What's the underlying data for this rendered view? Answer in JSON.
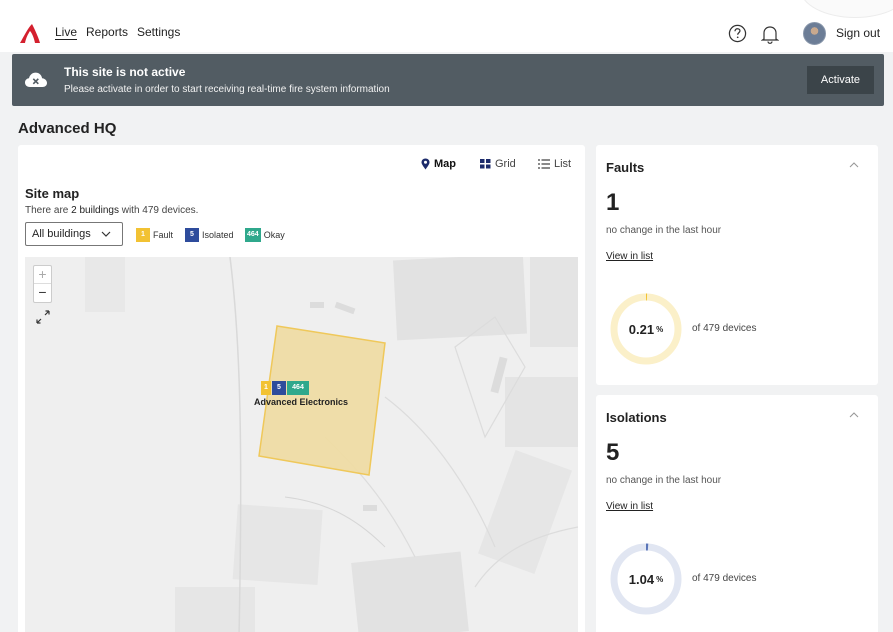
{
  "nav": {
    "links": [
      "Live",
      "Reports",
      "Settings"
    ],
    "signout": "Sign out",
    "brand_color": "#d4202e"
  },
  "banner": {
    "title": "This site is not active",
    "subtitle": "Please activate in order to start receiving real-time fire system information",
    "button": "Activate",
    "icon": "cloud-off-icon"
  },
  "page": {
    "title": "Advanced HQ"
  },
  "map_card": {
    "views": [
      "Map",
      "Grid",
      "List"
    ],
    "active_view": "Map",
    "heading": "Site map",
    "subtitle_pre": "There are ",
    "subtitle_bold": "2 buildings",
    "subtitle_post": " with 479 devices.",
    "building_filter": "All buildings",
    "legend": [
      {
        "count": "1",
        "label": "Fault",
        "color": "#f2c233"
      },
      {
        "count": "5",
        "label": "Isolated",
        "color": "#2e4c9c"
      },
      {
        "count": "464",
        "label": "Okay",
        "color": "#2fa88c"
      }
    ],
    "building": {
      "name": "Advanced Electronics",
      "counts": [
        "1",
        "5",
        "464"
      ]
    },
    "zoom_in": "+",
    "zoom_out": "−"
  },
  "faults": {
    "title": "Faults",
    "count": "1",
    "change": "no change in the last hour",
    "link": "View in list",
    "percent": "0.21",
    "percent_unit": "%",
    "fraction": 0.0021,
    "of_text": "of 479 devices",
    "ring_color": "#fbf0c9",
    "arc_color": "#f2c233"
  },
  "isolations": {
    "title": "Isolations",
    "count": "5",
    "change": "no change in the last hour",
    "link": "View in list",
    "percent": "1.04",
    "percent_unit": "%",
    "fraction": 0.0104,
    "of_text": "of 479 devices",
    "ring_color": "#e1e6f2",
    "arc_color": "#5a75b8"
  }
}
